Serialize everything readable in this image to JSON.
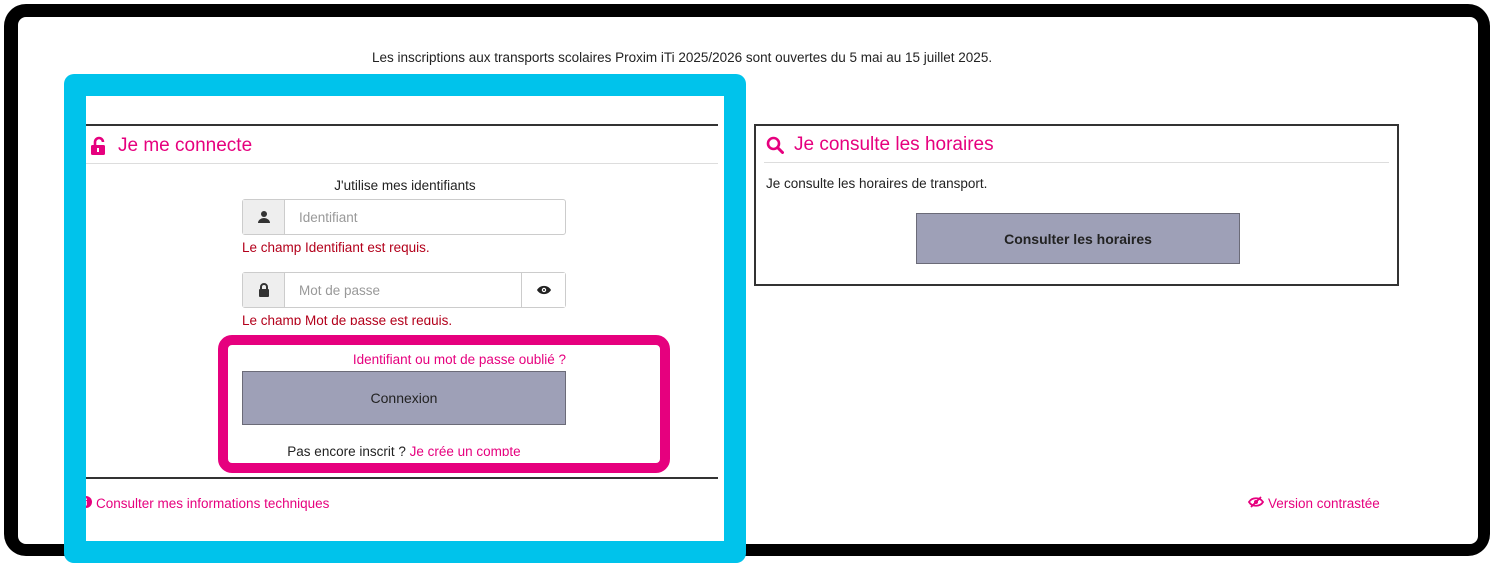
{
  "announcement": "Les inscriptions aux transports scolaires Proxim iTi 2025/2026 sont ouvertes du 5 mai au 15 juillet 2025.",
  "login": {
    "title": "Je me connecte",
    "subtitle": "J'utilise mes identifiants",
    "username_placeholder": "Identifiant",
    "username_error": "Le champ Identifiant est requis.",
    "password_placeholder": "Mot de passe",
    "password_error": "Le champ Mot de passe est requis.",
    "forgot_link": "Identifiant ou mot de passe oublié ?",
    "submit_label": "Connexion",
    "signup_prompt": "Pas encore inscrit ?",
    "signup_link": "Je crée un compte"
  },
  "hours": {
    "title": "Je consulte les horaires",
    "description": "Je consulte les horaires de transport.",
    "button_label": "Consulter les horaires"
  },
  "footer": {
    "info_link": "Consulter mes informations techniques",
    "contrast_link": "Version contrastée"
  },
  "colors": {
    "accent_pink": "#e6007e",
    "error_red": "#b3001b",
    "button_bg": "#9ea0b7",
    "highlight_blue": "#00c3eb",
    "highlight_pink": "#e6007e"
  },
  "icons": [
    "unlock-icon",
    "user-icon",
    "lock-icon",
    "eye-icon",
    "search-icon",
    "info-icon",
    "eye-slash-icon"
  ]
}
